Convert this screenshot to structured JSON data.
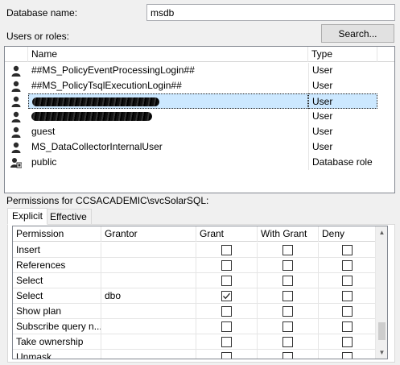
{
  "database": {
    "label": "Database name:",
    "value": "msdb"
  },
  "users_roles_label": "Users or roles:",
  "search_button": "Search...",
  "users_grid": {
    "columns": [
      "Name",
      "Type"
    ],
    "rows": [
      {
        "name": "##MS_PolicyEventProcessingLogin##",
        "type": "User",
        "icon": "user-icon"
      },
      {
        "name": "##MS_PolicyTsqlExecutionLogin##",
        "type": "User",
        "icon": "user-icon"
      },
      {
        "name": "",
        "type": "User",
        "icon": "user-icon",
        "redacted": true,
        "selected": true
      },
      {
        "name": "",
        "type": "User",
        "icon": "user-icon",
        "redacted": true
      },
      {
        "name": "guest",
        "type": "User",
        "icon": "user-icon"
      },
      {
        "name": "MS_DataCollectorInternalUser",
        "type": "User",
        "icon": "user-icon"
      },
      {
        "name": "public",
        "type": "Database role",
        "icon": "role-icon"
      }
    ]
  },
  "permissions_for_label": "Permissions for CCSACADEMIC\\svcSolarSQL:",
  "tabs": [
    "Explicit",
    "Effective"
  ],
  "permissions_grid": {
    "columns": [
      "Permission",
      "Grantor",
      "Grant",
      "With Grant",
      "Deny"
    ],
    "rows": [
      {
        "permission": "Insert",
        "grantor": "",
        "grant": false,
        "with_grant": false,
        "deny": false
      },
      {
        "permission": "References",
        "grantor": "",
        "grant": false,
        "with_grant": false,
        "deny": false
      },
      {
        "permission": "Select",
        "grantor": "",
        "grant": false,
        "with_grant": false,
        "deny": false
      },
      {
        "permission": "Select",
        "grantor": "dbo",
        "grant": true,
        "with_grant": false,
        "deny": false
      },
      {
        "permission": "Show plan",
        "grantor": "",
        "grant": false,
        "with_grant": false,
        "deny": false
      },
      {
        "permission": "Subscribe query n...",
        "grantor": "",
        "grant": false,
        "with_grant": false,
        "deny": false
      },
      {
        "permission": "Take ownership",
        "grantor": "",
        "grant": false,
        "with_grant": false,
        "deny": false
      },
      {
        "permission": "Unmask",
        "grantor": "",
        "grant": false,
        "with_grant": false,
        "deny": false
      }
    ]
  }
}
